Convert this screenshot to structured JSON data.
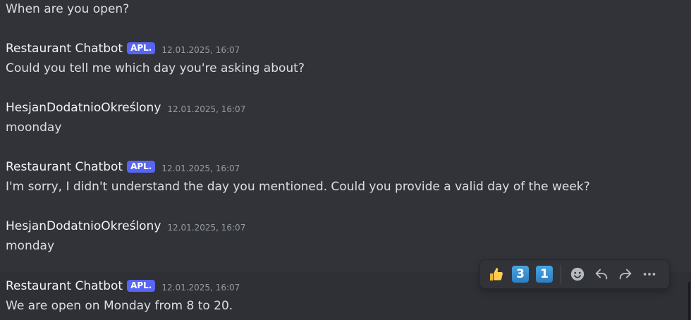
{
  "first_line": "When are you open?",
  "messages": [
    {
      "author": "Restaurant Chatbot",
      "badge": "APL.",
      "timestamp": "12.01.2025, 16:07",
      "text": "Could you tell me which day you're asking about?"
    },
    {
      "author": "HesjanDodatnioOkreślony",
      "badge": "",
      "timestamp": "12.01.2025, 16:07",
      "text": "moonday"
    },
    {
      "author": "Restaurant Chatbot",
      "badge": "APL.",
      "timestamp": "12.01.2025, 16:07",
      "text": "I'm sorry, I didn't understand the day you mentioned. Could you provide a valid day of the week?"
    },
    {
      "author": "HesjanDodatnioOkreślony",
      "badge": "",
      "timestamp": "12.01.2025, 16:07",
      "text": "monday"
    },
    {
      "author": "Restaurant Chatbot",
      "badge": "APL.",
      "timestamp": "12.01.2025, 16:07",
      "text": "We are open on Monday from 8 to 20."
    }
  ],
  "toolbar": {
    "reactions": [
      {
        "icon": "thumbs-up-icon",
        "glyph": "👍"
      },
      {
        "icon": "keycap-3-icon",
        "glyph": "3"
      },
      {
        "icon": "keycap-1-icon",
        "glyph": "1"
      }
    ],
    "actions": [
      {
        "icon": "add-reaction-icon"
      },
      {
        "icon": "reply-icon"
      },
      {
        "icon": "forward-icon"
      },
      {
        "icon": "more-icon"
      }
    ]
  },
  "colors": {
    "background": "#313338",
    "hover_background": "#2e3035",
    "badge": "#5865f2",
    "author": "#f2f3f5",
    "text": "#dbdee1",
    "timestamp": "#949ba4"
  }
}
